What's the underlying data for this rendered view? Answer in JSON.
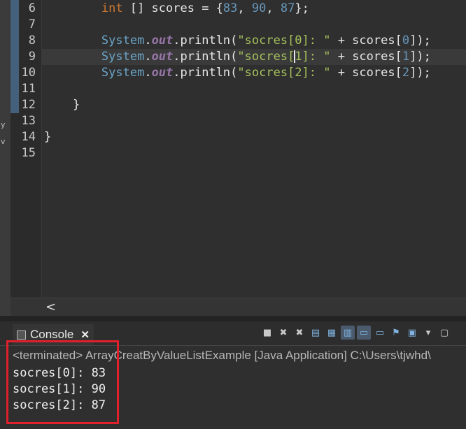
{
  "editor": {
    "lines": [
      {
        "number": "6",
        "tokens": [
          {
            "t": "plain",
            "v": "        "
          },
          {
            "t": "kw",
            "v": "int"
          },
          {
            "t": "plain",
            "v": " [] scores = {"
          },
          {
            "t": "num",
            "v": "83"
          },
          {
            "t": "plain",
            "v": ", "
          },
          {
            "t": "num",
            "v": "90"
          },
          {
            "t": "plain",
            "v": ", "
          },
          {
            "t": "num",
            "v": "87"
          },
          {
            "t": "plain",
            "v": "};"
          }
        ]
      },
      {
        "number": "7",
        "tokens": []
      },
      {
        "number": "8",
        "tokens": [
          {
            "t": "plain",
            "v": "        "
          },
          {
            "t": "sys",
            "v": "System"
          },
          {
            "t": "plain",
            "v": "."
          },
          {
            "t": "out",
            "v": "out"
          },
          {
            "t": "plain",
            "v": ".println("
          },
          {
            "t": "str",
            "v": "\"socres[0]: \""
          },
          {
            "t": "plain",
            "v": " + scores["
          },
          {
            "t": "num",
            "v": "0"
          },
          {
            "t": "plain",
            "v": "]);"
          }
        ]
      },
      {
        "number": "9",
        "tokens": [
          {
            "t": "plain",
            "v": "        "
          },
          {
            "t": "sys",
            "v": "System"
          },
          {
            "t": "plain",
            "v": "."
          },
          {
            "t": "out",
            "v": "out"
          },
          {
            "t": "plain",
            "v": ".println("
          },
          {
            "t": "str",
            "v": "\"socres["
          },
          {
            "t": "caret",
            "v": ""
          },
          {
            "t": "str",
            "v": "1]: \""
          },
          {
            "t": "plain",
            "v": " + scores["
          },
          {
            "t": "num",
            "v": "1"
          },
          {
            "t": "plain",
            "v": "]);"
          }
        ]
      },
      {
        "number": "10",
        "tokens": [
          {
            "t": "plain",
            "v": "        "
          },
          {
            "t": "sys",
            "v": "System"
          },
          {
            "t": "plain",
            "v": "."
          },
          {
            "t": "out",
            "v": "out"
          },
          {
            "t": "plain",
            "v": ".println("
          },
          {
            "t": "str",
            "v": "\"socres[2]: \""
          },
          {
            "t": "plain",
            "v": " + scores["
          },
          {
            "t": "num",
            "v": "2"
          },
          {
            "t": "plain",
            "v": "]);"
          }
        ]
      },
      {
        "number": "11",
        "tokens": []
      },
      {
        "number": "12",
        "tokens": [
          {
            "t": "plain",
            "v": "    }"
          }
        ]
      },
      {
        "number": "13",
        "tokens": []
      },
      {
        "number": "14",
        "tokens": [
          {
            "t": "plain",
            "v": "}"
          }
        ]
      },
      {
        "number": "15",
        "tokens": []
      }
    ],
    "current_line_index": 3,
    "scroll_left_icon": "chevron-left-icon",
    "scroll_left_glyph": "<"
  },
  "left_strip": {
    "glyph_1": "y",
    "glyph_2": "v"
  },
  "console": {
    "tab_label": "Console",
    "close_glyph": "✕",
    "toolbar_icons": [
      "terminate-icon",
      "remove-launch-icon",
      "remove-all-icon",
      "clear-console-icon",
      "scroll-lock-icon",
      "word-wrap-icon",
      "show-on-stdout-icon",
      "show-on-stderr-icon",
      "pin-console-icon",
      "display-selected-console-icon",
      "dropdown-icon",
      "open-console-icon"
    ],
    "toolbar_glyphs": [
      "■",
      "✖",
      "✖",
      "▤",
      "▦",
      "▥",
      "▭",
      "▭",
      "⚑",
      "▣",
      "▾",
      "▢"
    ],
    "terminated_text": "<terminated> ArrayCreatByValueListExample [Java Application] C:\\Users\\tjwhd\\",
    "output_lines": [
      "socres[0]: 83",
      "socres[1]: 90",
      "socres[2]: 87"
    ]
  },
  "annotation": {
    "box_color": "#e0202a"
  }
}
